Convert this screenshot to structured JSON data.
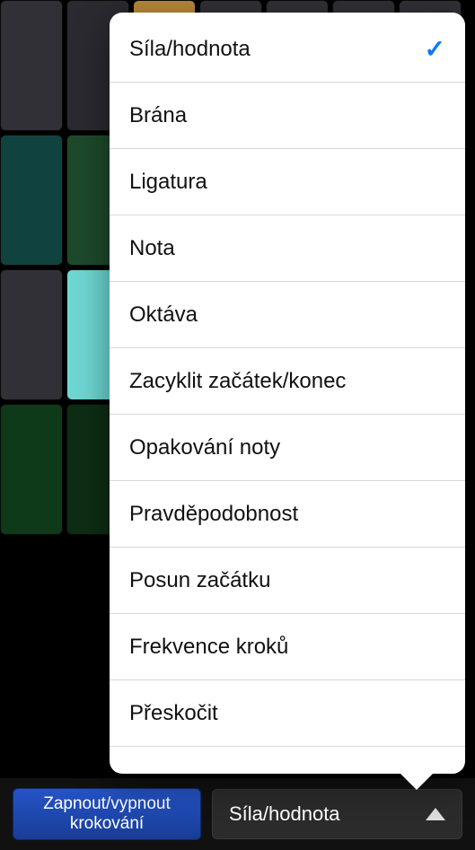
{
  "menu": {
    "items": [
      {
        "label": "Síla/hodnota",
        "selected": true
      },
      {
        "label": "Brána",
        "selected": false
      },
      {
        "label": "Ligatura",
        "selected": false
      },
      {
        "label": "Nota",
        "selected": false
      },
      {
        "label": "Oktáva",
        "selected": false
      },
      {
        "label": "Zacyklit začátek/konec",
        "selected": false
      },
      {
        "label": "Opakování noty",
        "selected": false
      },
      {
        "label": "Pravděpodobnost",
        "selected": false
      },
      {
        "label": "Posun začátku",
        "selected": false
      },
      {
        "label": "Frekvence kroků",
        "selected": false
      },
      {
        "label": "Přeskočit",
        "selected": false
      }
    ]
  },
  "toolbar": {
    "toggle_label": "Zapnout/vypnout krokování",
    "mode_label": "Síla/hodnota"
  },
  "colors": {
    "accent_check": "#0a7aff",
    "primary_button": "#1e4bb8"
  }
}
